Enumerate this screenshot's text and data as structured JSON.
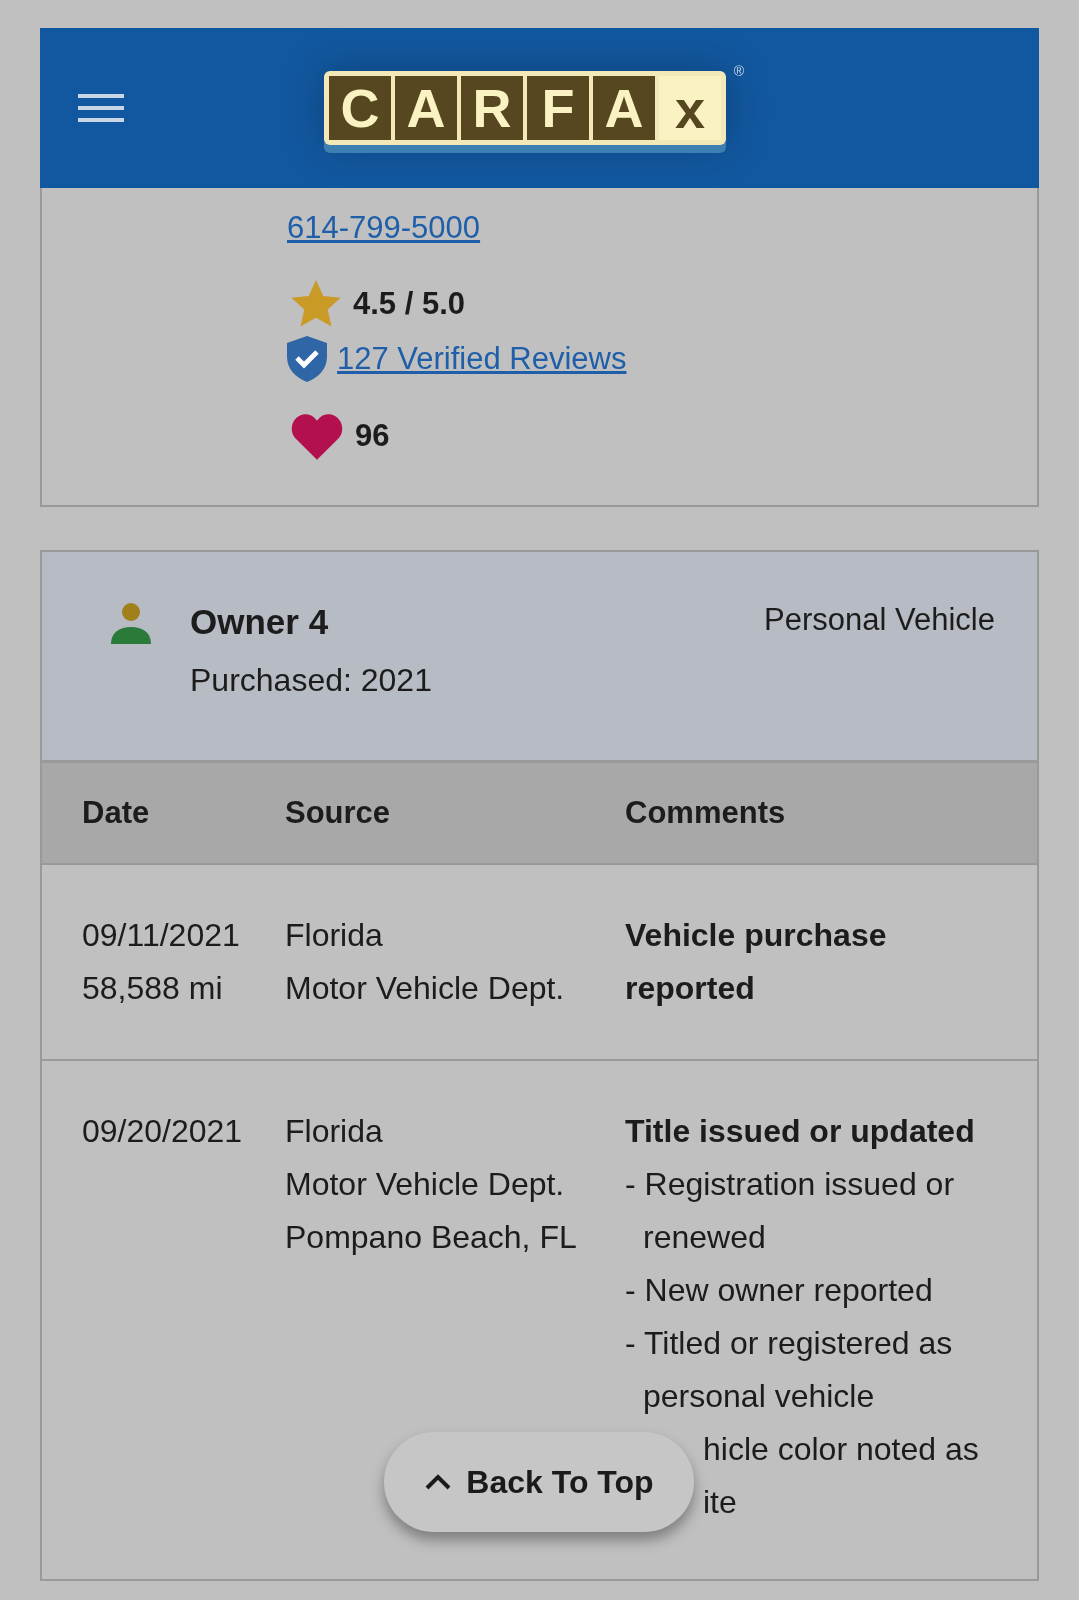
{
  "header": {
    "logo_letters": [
      "C",
      "A",
      "R",
      "F",
      "A",
      "x"
    ],
    "registered_mark": "®"
  },
  "dealer": {
    "phone": "614-799-5000",
    "rating": "4.5 / 5.0",
    "reviews": "127 Verified Reviews",
    "favorites": "96"
  },
  "owner": {
    "title": "Owner 4",
    "purchased": "Purchased: 2021",
    "usage": "Personal Vehicle"
  },
  "table": {
    "columns": [
      "Date",
      "Source",
      "Comments"
    ],
    "rows": [
      {
        "date": "09/11/2021",
        "mileage": "58,588 mi",
        "source": [
          "Florida",
          "Motor Vehicle Dept."
        ],
        "headline": "Vehicle purchase reported",
        "details": []
      },
      {
        "date": "09/20/2021",
        "source": [
          "Florida",
          "Motor Vehicle Dept.",
          "Pompano Beach, FL"
        ],
        "headline": "Title issued or updated",
        "details": [
          {
            "kind": "bullet",
            "text": "- Registration issued or renewed"
          },
          {
            "kind": "bullet",
            "text": "- New owner reported"
          },
          {
            "kind": "bullet",
            "text": "- Titled or registered as personal vehicle"
          },
          {
            "kind": "covered",
            "text": "hicle color noted as"
          },
          {
            "kind": "covered",
            "text": "ite"
          }
        ]
      }
    ]
  },
  "back_to_top": "Back To Top"
}
